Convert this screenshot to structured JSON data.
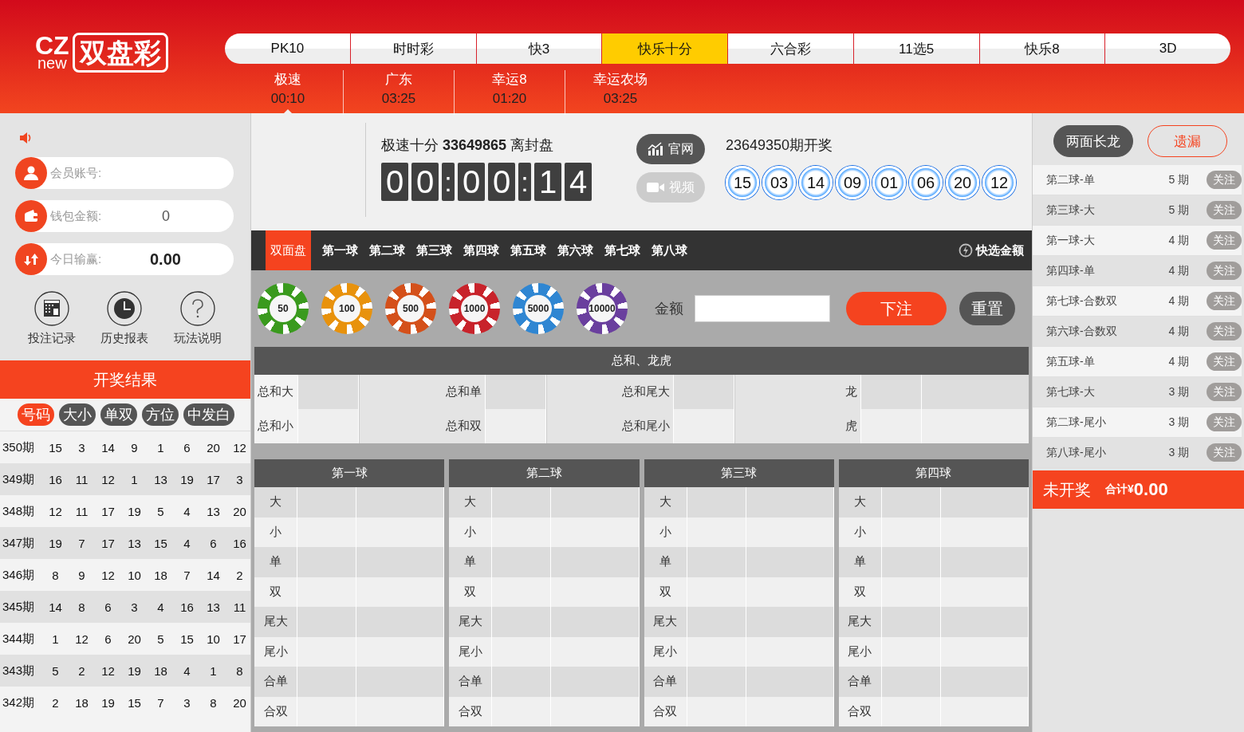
{
  "logo": {
    "mark_top": "CZ",
    "mark_bottom": "new",
    "name": "双盘彩"
  },
  "nav": [
    {
      "label": "PK10",
      "selected": false
    },
    {
      "label": "时时彩",
      "selected": false
    },
    {
      "label": "快3",
      "selected": false
    },
    {
      "label": "快乐十分",
      "selected": true
    },
    {
      "label": "六合彩",
      "selected": false
    },
    {
      "label": "11选5",
      "selected": false
    },
    {
      "label": "快乐8",
      "selected": false
    },
    {
      "label": "3D",
      "selected": false
    }
  ],
  "subnav": [
    {
      "name": "极速",
      "time": "00:10",
      "selected": true
    },
    {
      "name": "广东",
      "time": "03:25",
      "selected": false
    },
    {
      "name": "幸运8",
      "time": "01:20",
      "selected": false
    },
    {
      "name": "幸运农场",
      "time": "03:25",
      "selected": false
    }
  ],
  "account": [
    {
      "kind": "user",
      "label": "会员账号:"
    },
    {
      "kind": "wallet",
      "label": "钱包金额:",
      "value": "0"
    },
    {
      "kind": "profit",
      "label": "今日输赢:",
      "value": "0.00"
    }
  ],
  "shortcuts": [
    {
      "kind": "lotto",
      "label": "投注记录"
    },
    {
      "kind": "clock",
      "label": "历史报表"
    },
    {
      "kind": "help",
      "label": "玩法说明"
    }
  ],
  "results": {
    "title": "开奖结果",
    "filters": [
      {
        "label": "号码",
        "selected": true
      },
      {
        "label": "大小",
        "selected": false
      },
      {
        "label": "单双",
        "selected": false
      },
      {
        "label": "方位",
        "selected": false
      },
      {
        "label": "中发白",
        "selected": false
      }
    ],
    "rows": [
      {
        "issue": "350期",
        "numbers": [
          "15",
          "3",
          "14",
          "9",
          "1",
          "6",
          "20",
          "12"
        ]
      },
      {
        "issue": "349期",
        "numbers": [
          "16",
          "11",
          "12",
          "1",
          "13",
          "19",
          "17",
          "3"
        ]
      },
      {
        "issue": "348期",
        "numbers": [
          "12",
          "11",
          "17",
          "19",
          "5",
          "4",
          "13",
          "20"
        ]
      },
      {
        "issue": "347期",
        "numbers": [
          "19",
          "7",
          "17",
          "13",
          "15",
          "4",
          "6",
          "16"
        ]
      },
      {
        "issue": "346期",
        "numbers": [
          "8",
          "9",
          "12",
          "10",
          "18",
          "7",
          "14",
          "2"
        ]
      },
      {
        "issue": "345期",
        "numbers": [
          "14",
          "8",
          "6",
          "3",
          "4",
          "16",
          "13",
          "11"
        ]
      },
      {
        "issue": "344期",
        "numbers": [
          "1",
          "12",
          "6",
          "20",
          "5",
          "15",
          "10",
          "17"
        ]
      },
      {
        "issue": "343期",
        "numbers": [
          "5",
          "2",
          "12",
          "19",
          "18",
          "4",
          "1",
          "8"
        ]
      },
      {
        "issue": "342期",
        "numbers": [
          "2",
          "18",
          "19",
          "15",
          "7",
          "3",
          "8",
          "20"
        ]
      }
    ]
  },
  "draw": {
    "title": "极速十分 **33649865** 离封盘",
    "countdown": [
      "0",
      "0",
      ":",
      "0",
      "0",
      ":",
      "1",
      "4"
    ],
    "links": [
      {
        "kind": "site",
        "label": "官网",
        "disabled": false
      },
      {
        "kind": "video",
        "label": "视频",
        "disabled": true
      }
    ],
    "last_title": "23649350期开奖",
    "balls": [
      "15",
      "03",
      "14",
      "09",
      "01",
      "06",
      "20",
      "12"
    ]
  },
  "bet_tabs": [
    {
      "label": "双面盘",
      "selected": true
    },
    {
      "label": "第一球",
      "selected": false
    },
    {
      "label": "第二球",
      "selected": false
    },
    {
      "label": "第三球",
      "selected": false
    },
    {
      "label": "第四球",
      "selected": false
    },
    {
      "label": "第五球",
      "selected": false
    },
    {
      "label": "第六球",
      "selected": false
    },
    {
      "label": "第七球",
      "selected": false
    },
    {
      "label": "第八球",
      "selected": false
    }
  ],
  "quick_amount": "快选金额",
  "chips": [
    {
      "value": "50",
      "color": "#3a9a1e"
    },
    {
      "value": "100",
      "color": "#e8920c"
    },
    {
      "value": "500",
      "color": "#d4501a"
    },
    {
      "value": "1000",
      "color": "#c8232b"
    },
    {
      "value": "5000",
      "color": "#2f86d2"
    },
    {
      "value": "10000",
      "color": "#6a3f9e"
    }
  ],
  "amount_label": "金额",
  "submit": "下注",
  "reset": "重置",
  "sum_table": {
    "title": "总和、龙虎",
    "rows": [
      [
        "总和大",
        "总和单",
        "总和尾大",
        "龙"
      ],
      [
        "总和小",
        "总和双",
        "总和尾小",
        "虎"
      ]
    ]
  },
  "ball_tables": [
    {
      "title": "第一球",
      "rows": [
        "大",
        "小",
        "单",
        "双",
        "尾大",
        "尾小",
        "合单",
        "合双"
      ]
    },
    {
      "title": "第二球",
      "rows": [
        "大",
        "小",
        "单",
        "双",
        "尾大",
        "尾小",
        "合单",
        "合双"
      ]
    },
    {
      "title": "第三球",
      "rows": [
        "大",
        "小",
        "单",
        "双",
        "尾大",
        "尾小",
        "合单",
        "合双"
      ]
    },
    {
      "title": "第四球",
      "rows": [
        "大",
        "小",
        "单",
        "双",
        "尾大",
        "尾小",
        "合单",
        "合双"
      ]
    }
  ],
  "side_tabs": [
    {
      "label": "两面长龙",
      "selected": true
    },
    {
      "label": "遗漏",
      "selected": false
    }
  ],
  "streaks": [
    {
      "name": "第二球-单",
      "count": "5 期",
      "action": "关注"
    },
    {
      "name": "第三球-大",
      "count": "5 期",
      "action": "关注"
    },
    {
      "name": "第一球-大",
      "count": "4 期",
      "action": "关注"
    },
    {
      "name": "第四球-单",
      "count": "4 期",
      "action": "关注"
    },
    {
      "name": "第七球-合数双",
      "count": "4 期",
      "action": "关注"
    },
    {
      "name": "第六球-合数双",
      "count": "4 期",
      "action": "关注"
    },
    {
      "name": "第五球-单",
      "count": "4 期",
      "action": "关注"
    },
    {
      "name": "第七球-大",
      "count": "3 期",
      "action": "关注"
    },
    {
      "name": "第二球-尾小",
      "count": "3 期",
      "action": "关注"
    },
    {
      "name": "第八球-尾小",
      "count": "3 期",
      "action": "关注"
    }
  ],
  "footer": {
    "status": "未开奖",
    "total_label": "合计¥",
    "total": "0.00"
  }
}
